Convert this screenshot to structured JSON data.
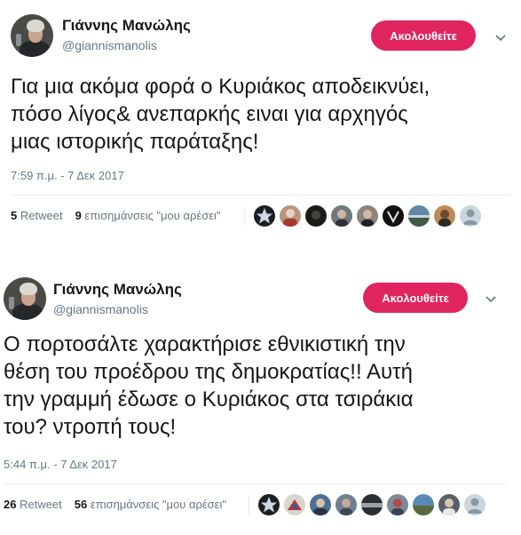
{
  "tweets": [
    {
      "author_name": "Γιάννης Μανώλης",
      "handle": "@giannismanolis",
      "follow_label": "Ακολουθείτε",
      "text_lines": [
        "Για μια ακόμα φορά ο Κυριάκος αποδεικνύει,",
        "πόσο λίγος& ανεπαρκής ειναι για αρχηγός",
        "μιας ιστορικής παράταξης!"
      ],
      "timestamp": "7:59 π.μ. - 7 Δεκ 2017",
      "retweet_count": "5",
      "retweet_label": "Retweet",
      "like_count": "9",
      "like_label": "επισημάνσεις \"μου αρέσει\"",
      "liker_avatars": [
        "star-avatar",
        "photo-avatar",
        "photo-avatar",
        "photo-avatar",
        "photo-avatar",
        "photo-avatar",
        "photo-avatar",
        "photo-avatar",
        "default-avatar"
      ],
      "menu_icon": "chevron-down-icon"
    },
    {
      "author_name": "Γιάννης Μανώλης",
      "handle": "@giannismanolis",
      "follow_label": "Ακολουθείτε",
      "text_lines": [
        "Ο πορτοσάλτε χαρακτήρισε εθνικιστική την",
        "θέση του προέδρου της δημοκρατίας!! Αυτή",
        "την γραμμή έδωσε ο Κυριάκος στα τσιράκια",
        "του? ντροπή τους!"
      ],
      "timestamp": "5:44 π.μ. - 7 Δεκ 2017",
      "retweet_count": "26",
      "retweet_label": "Retweet",
      "like_count": "56",
      "like_label": "επισημάνσεις \"μου αρέσει\"",
      "liker_avatars": [
        "star-avatar",
        "photo-avatar",
        "photo-avatar",
        "photo-avatar",
        "photo-avatar",
        "photo-avatar",
        "photo-avatar",
        "photo-avatar",
        "default-avatar"
      ],
      "menu_icon": "chevron-down-icon"
    }
  ],
  "colors": {
    "follow_button": "#e0245e",
    "secondary_text": "#657786",
    "primary_text": "#14171a",
    "divider": "#e6ecf0"
  }
}
